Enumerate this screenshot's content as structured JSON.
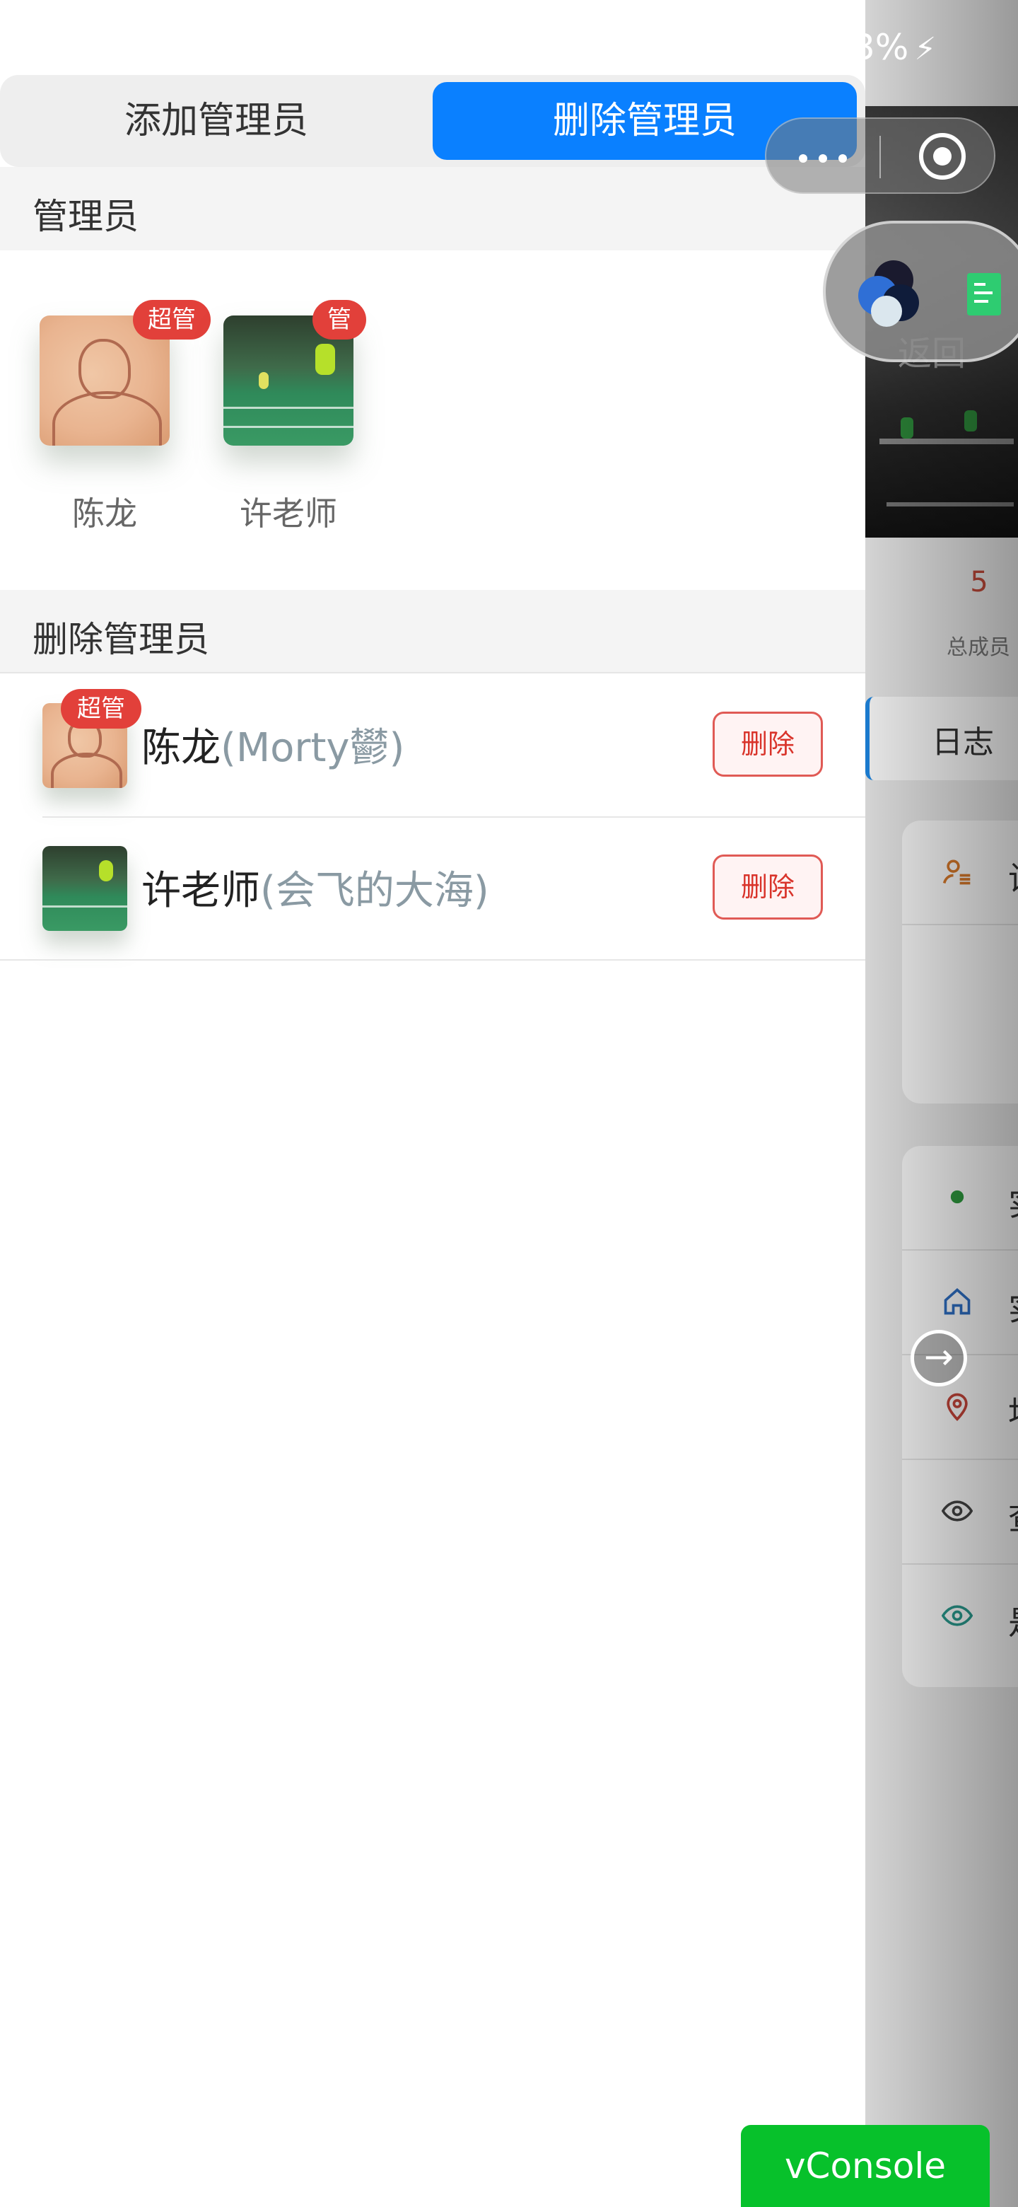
{
  "status_bar": {
    "battery_text": "3%"
  },
  "tabs": {
    "add_label": "添加管理员",
    "delete_label": "删除管理员",
    "active": "delete"
  },
  "admins_section": {
    "title": "管理员",
    "items": [
      {
        "name": "陈龙",
        "badge": "超管",
        "avatar": "sketch-portrait"
      },
      {
        "name": "许老师",
        "badge": "管",
        "avatar": "badminton-court-photo"
      }
    ]
  },
  "delete_section": {
    "title": "删除管理员",
    "rows": [
      {
        "name": "陈龙",
        "nickname": "(Morty鬰)",
        "badge": "超管",
        "delete_label": "删除"
      },
      {
        "name": "许老师",
        "nickname": "(会飞的大海)",
        "badge": "",
        "delete_label": "删除"
      }
    ]
  },
  "background_page": {
    "return_label": "返回",
    "member_count": "5",
    "member_count_label": "总成员",
    "log_button": "日志",
    "card_rows": [
      "设",
      "实",
      "实",
      "地",
      "查",
      "是"
    ]
  },
  "vconsole_label": "vConsole",
  "colors": {
    "primary": "#0a80ff",
    "danger": "#e2403a",
    "vconsole": "#07c12b",
    "section_bg": "#f4f4f4"
  }
}
